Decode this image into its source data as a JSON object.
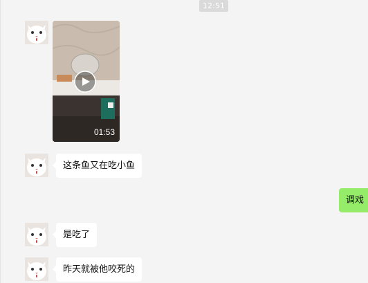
{
  "chat": {
    "timestamp": "12:51",
    "video": {
      "duration": "01:53",
      "icon": "play-icon"
    },
    "messages": [
      {
        "side": "left",
        "text": "这条鱼又在吃小鱼"
      },
      {
        "side": "right",
        "text": "调戏"
      },
      {
        "side": "left",
        "text": "是吃了"
      },
      {
        "side": "left",
        "text": "昨天就被他咬死的"
      }
    ]
  },
  "colors": {
    "background": "#f4f4f4",
    "incoming_bubble": "#ffffff",
    "outgoing_bubble": "#95ec69",
    "timestamp_bg": "#dadada"
  }
}
